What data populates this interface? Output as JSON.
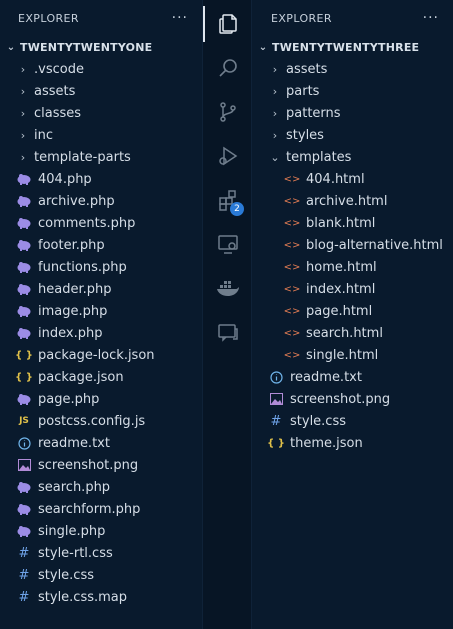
{
  "left": {
    "title": "EXPLORER",
    "more": "···",
    "root": "TWENTYTWENTYONE",
    "items": [
      {
        "label": ".vscode",
        "type": "folder"
      },
      {
        "label": "assets",
        "type": "folder"
      },
      {
        "label": "classes",
        "type": "folder"
      },
      {
        "label": "inc",
        "type": "folder"
      },
      {
        "label": "template-parts",
        "type": "folder"
      },
      {
        "label": "404.php",
        "type": "php"
      },
      {
        "label": "archive.php",
        "type": "php"
      },
      {
        "label": "comments.php",
        "type": "php"
      },
      {
        "label": "footer.php",
        "type": "php"
      },
      {
        "label": "functions.php",
        "type": "php"
      },
      {
        "label": "header.php",
        "type": "php"
      },
      {
        "label": "image.php",
        "type": "php"
      },
      {
        "label": "index.php",
        "type": "php"
      },
      {
        "label": "package-lock.json",
        "type": "json"
      },
      {
        "label": "package.json",
        "type": "json"
      },
      {
        "label": "page.php",
        "type": "php"
      },
      {
        "label": "postcss.config.js",
        "type": "js"
      },
      {
        "label": "readme.txt",
        "type": "info"
      },
      {
        "label": "screenshot.png",
        "type": "image"
      },
      {
        "label": "search.php",
        "type": "php"
      },
      {
        "label": "searchform.php",
        "type": "php"
      },
      {
        "label": "single.php",
        "type": "php"
      },
      {
        "label": "style-rtl.css",
        "type": "css"
      },
      {
        "label": "style.css",
        "type": "css"
      },
      {
        "label": "style.css.map",
        "type": "css"
      }
    ]
  },
  "activity_bar": {
    "items": [
      {
        "name": "explorer",
        "active": true
      },
      {
        "name": "search"
      },
      {
        "name": "source-control"
      },
      {
        "name": "run-debug"
      },
      {
        "name": "extensions",
        "badge": "2"
      },
      {
        "name": "remote-explorer"
      },
      {
        "name": "docker"
      },
      {
        "name": "live-share"
      }
    ]
  },
  "right": {
    "title": "EXPLORER",
    "more": "···",
    "root": "TWENTYTWENTYTHREE",
    "items": [
      {
        "label": "assets",
        "type": "folder"
      },
      {
        "label": "parts",
        "type": "folder"
      },
      {
        "label": "patterns",
        "type": "folder"
      },
      {
        "label": "styles",
        "type": "folder"
      },
      {
        "label": "templates",
        "type": "folder-open"
      },
      {
        "label": "404.html",
        "type": "html"
      },
      {
        "label": "archive.html",
        "type": "html"
      },
      {
        "label": "blank.html",
        "type": "html"
      },
      {
        "label": "blog-alternative.html",
        "type": "html"
      },
      {
        "label": "home.html",
        "type": "html"
      },
      {
        "label": "index.html",
        "type": "html"
      },
      {
        "label": "page.html",
        "type": "html"
      },
      {
        "label": "search.html",
        "type": "html"
      },
      {
        "label": "single.html",
        "type": "html"
      },
      {
        "label": "readme.txt",
        "type": "info"
      },
      {
        "label": "screenshot.png",
        "type": "image"
      },
      {
        "label": "style.css",
        "type": "css"
      },
      {
        "label": "theme.json",
        "type": "json"
      }
    ]
  },
  "colors": {
    "background": "#091a2d",
    "activity_bar": "#071525",
    "badge": "#2a7ad6",
    "php_icon": "#9b8ce6",
    "json_icon": "#e0c14a",
    "html_icon": "#e37d54",
    "css_icon": "#6fa3e8"
  }
}
